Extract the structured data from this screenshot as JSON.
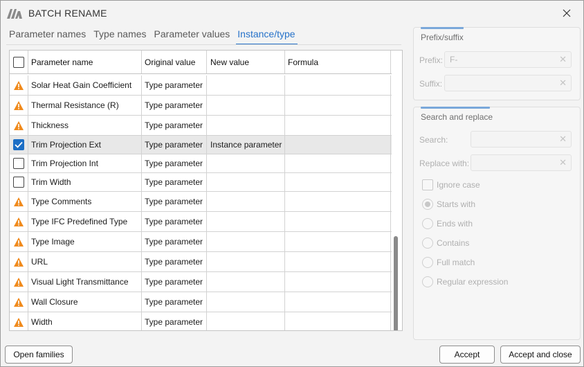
{
  "window": {
    "title": "BATCH RENAME"
  },
  "tabs": [
    {
      "label": "Parameter names",
      "active": false
    },
    {
      "label": "Type names",
      "active": false
    },
    {
      "label": "Parameter values",
      "active": false
    },
    {
      "label": "Instance/type",
      "active": true
    }
  ],
  "grid": {
    "columns": [
      "Parameter name",
      "Original value",
      "New value",
      "Formula"
    ],
    "rows": [
      {
        "icon": "warning-icon",
        "name": "Solar Heat Gain Coefficient",
        "original": "Type parameter",
        "new": "",
        "formula": ""
      },
      {
        "icon": "warning-icon",
        "name": "Thermal Resistance (R)",
        "original": "Type parameter",
        "new": "",
        "formula": ""
      },
      {
        "icon": "warning-icon",
        "name": "Thickness",
        "original": "Type parameter",
        "new": "",
        "formula": ""
      },
      {
        "icon": "checkbox-checked",
        "name": "Trim Projection Ext",
        "original": "Type parameter",
        "new": "Instance parameter",
        "formula": ""
      },
      {
        "icon": "checkbox-empty",
        "name": "Trim Projection Int",
        "original": "Type parameter",
        "new": "",
        "formula": ""
      },
      {
        "icon": "checkbox-empty",
        "name": "Trim Width",
        "original": "Type parameter",
        "new": "",
        "formula": ""
      },
      {
        "icon": "warning-icon",
        "name": "Type Comments",
        "original": "Type parameter",
        "new": "",
        "formula": ""
      },
      {
        "icon": "warning-icon",
        "name": "Type IFC Predefined Type",
        "original": "Type parameter",
        "new": "",
        "formula": ""
      },
      {
        "icon": "warning-icon",
        "name": "Type Image",
        "original": "Type parameter",
        "new": "",
        "formula": ""
      },
      {
        "icon": "warning-icon",
        "name": "URL",
        "original": "Type parameter",
        "new": "",
        "formula": ""
      },
      {
        "icon": "warning-icon",
        "name": "Visual Light Transmittance",
        "original": "Type parameter",
        "new": "",
        "formula": ""
      },
      {
        "icon": "warning-icon",
        "name": "Wall Closure",
        "original": "Type parameter",
        "new": "",
        "formula": ""
      },
      {
        "icon": "warning-icon",
        "name": "Width",
        "original": "Type parameter",
        "new": "",
        "formula": ""
      }
    ]
  },
  "prefix_suffix": {
    "title": "Prefix/suffix",
    "prefix_label": "Prefix:",
    "prefix_value": "F-",
    "suffix_label": "Suffix:",
    "suffix_value": ""
  },
  "search_replace": {
    "title": "Search and replace",
    "search_label": "Search:",
    "search_value": "",
    "replace_label": "Replace with:",
    "replace_value": "",
    "ignore_case": "Ignore case",
    "options": [
      "Starts with",
      "Ends with",
      "Contains",
      "Full match",
      "Regular expression"
    ],
    "selected_option": "Starts with"
  },
  "buttons": {
    "open_families": "Open families",
    "accept": "Accept",
    "accept_close": "Accept and close"
  },
  "colors": {
    "accent": "#2672c9",
    "warning": "#f08a1c",
    "checked": "#1c6ec5"
  }
}
